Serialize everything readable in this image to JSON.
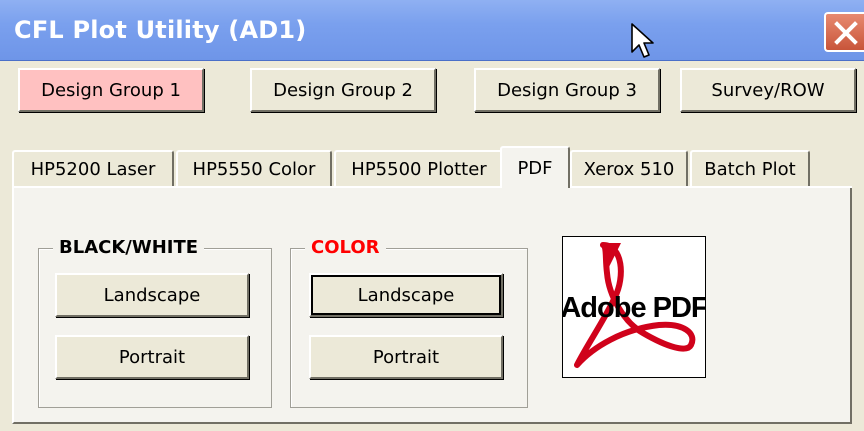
{
  "window": {
    "title": "CFL Plot Utility (AD1)"
  },
  "design_groups": [
    {
      "label": "Design Group 1",
      "active": true
    },
    {
      "label": "Design Group 2",
      "active": false
    },
    {
      "label": "Design Group 3",
      "active": false
    },
    {
      "label": "Survey/ROW",
      "active": false
    }
  ],
  "tabs": [
    {
      "label": "HP5200 Laser"
    },
    {
      "label": "HP5550 Color"
    },
    {
      "label": "HP5500 Plotter"
    },
    {
      "label": "PDF",
      "selected": true
    },
    {
      "label": "Xerox 510"
    },
    {
      "label": "Batch Plot"
    }
  ],
  "black_white": {
    "label": "BLACK/WHITE",
    "landscape": "Landscape",
    "portrait": "Portrait"
  },
  "color": {
    "label": "COLOR",
    "label_color": "#ff0000",
    "landscape": "Landscape",
    "portrait": "Portrait"
  },
  "pdf_logo": {
    "text": "Adobe PDF",
    "icon": "adobe-pdf-logo"
  },
  "colors": {
    "titlebar": "#7aa0ee",
    "active_group": "#ffc1c1",
    "window_bg": "#ece9d8",
    "close_button": "#d4654a"
  }
}
